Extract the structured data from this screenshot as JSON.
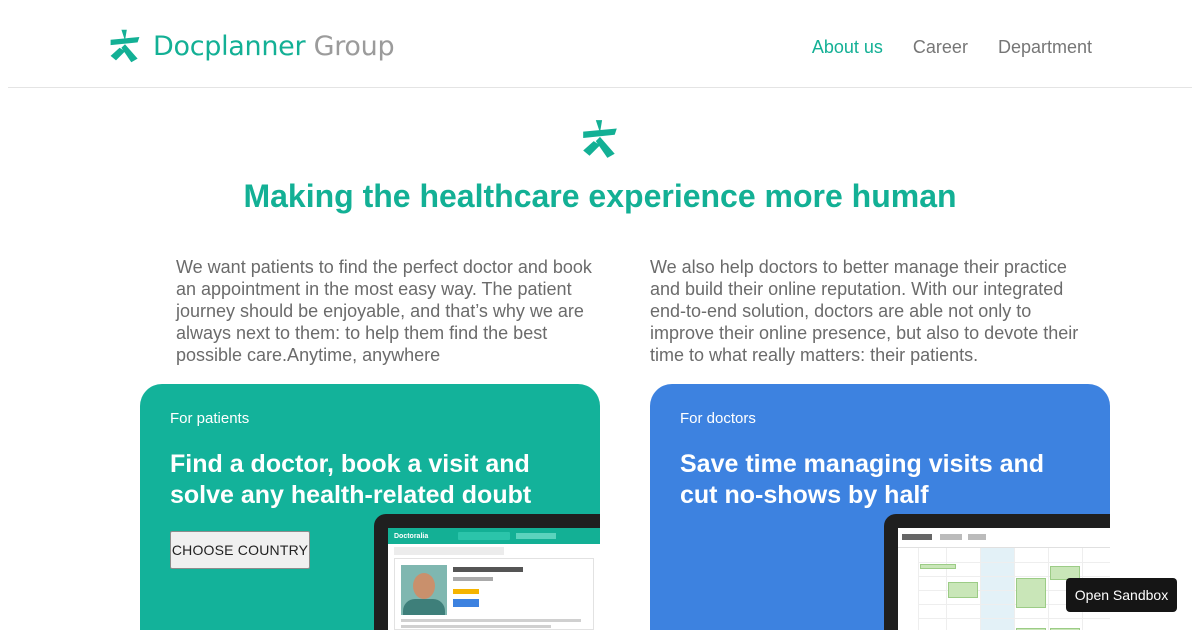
{
  "brand": {
    "name_primary": "Docplanner",
    "name_secondary": "Group",
    "color": "#13b095"
  },
  "nav": {
    "items": [
      {
        "label": "About us",
        "active": true
      },
      {
        "label": "Career",
        "active": false
      },
      {
        "label": "Department",
        "active": false
      }
    ]
  },
  "hero": {
    "title": "Making the healthcare experience more human",
    "icon": "docplanner-logo-icon"
  },
  "intro": {
    "left": "We want patients to find the perfect doctor and book an appointment in the most easy way. The patient journey should be enjoyable, and that’s why we are always next to them: to help them find the best possible care.Anytime, anywhere",
    "right": "We also help doctors to better manage their practice and build their online reputation. With our integrated end-to-end solution, doctors are able not only to improve their online presence, but also to devote their time to what really matters: their patients."
  },
  "cards": {
    "patients": {
      "eyebrow": "For patients",
      "title": "Find a doctor, book a visit and solve any health-related doubt",
      "button_label": "CHOOSE COUNTRY",
      "color": "#13b29a",
      "screen_brand": "Doctoralia"
    },
    "doctors": {
      "eyebrow": "For doctors",
      "title": "Save time managing visits and cut no-shows by half",
      "color": "#3d82e0"
    }
  },
  "sandbox": {
    "label": "Open Sandbox"
  }
}
